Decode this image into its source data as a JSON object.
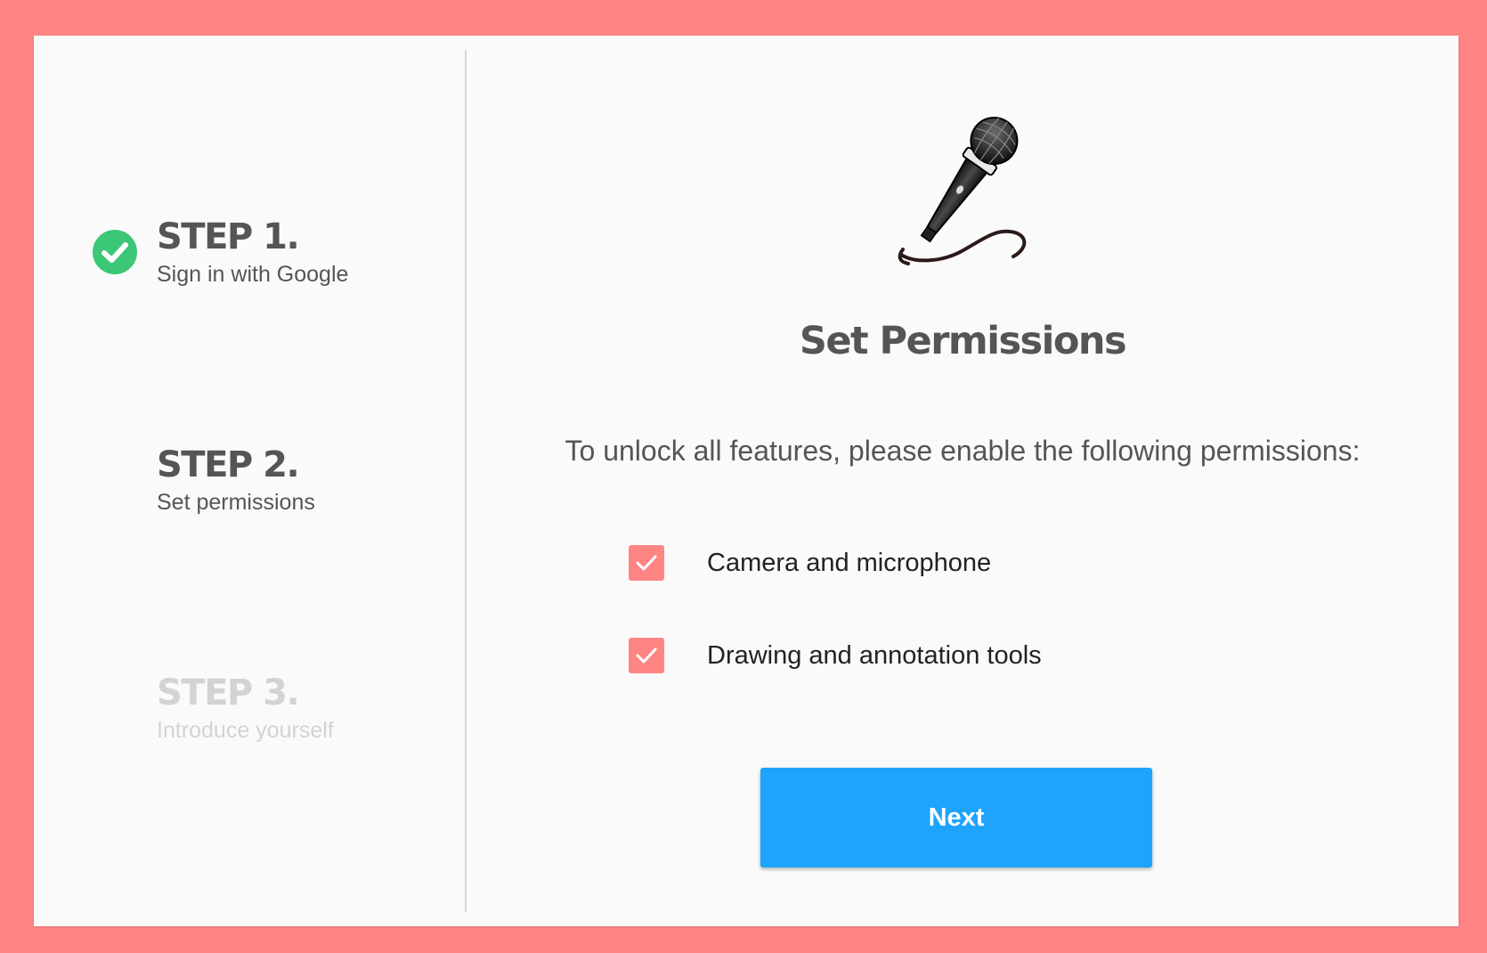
{
  "steps": [
    {
      "title": "STEP 1.",
      "subtitle": "Sign in with Google",
      "status": "completed"
    },
    {
      "title": "STEP 2.",
      "subtitle": "Set permissions",
      "status": "active"
    },
    {
      "title": "STEP 3.",
      "subtitle": "Introduce yourself",
      "status": "upcoming"
    }
  ],
  "main": {
    "icon": "microphone-icon",
    "title": "Set Permissions",
    "description": "To unlock all features, please enable the following permissions:",
    "permissions": [
      {
        "label": "Camera and microphone",
        "checked": true
      },
      {
        "label": "Drawing and annotation tools",
        "checked": true
      }
    ],
    "next_label": "Next"
  },
  "colors": {
    "background": "#ff8585",
    "card": "#fafafa",
    "completed_badge": "#3cc777",
    "checkbox": "#ff8585",
    "primary_button": "#1ea4fc",
    "text": "#555555",
    "disabled_text": "#d3d3d3"
  }
}
